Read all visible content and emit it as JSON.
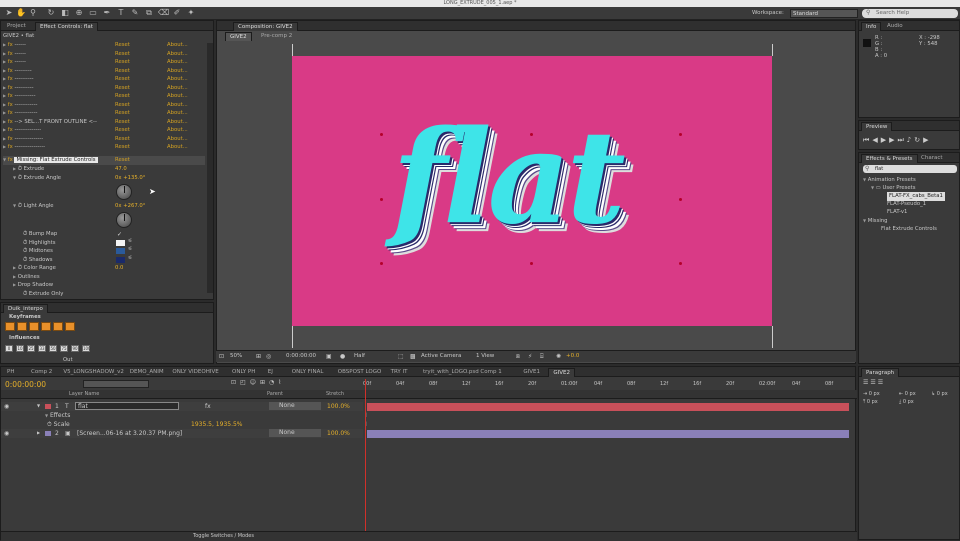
{
  "app": {
    "title": "LONG_EXTRUDE_005_1.aep *"
  },
  "workspace": {
    "label": "Workspace:",
    "value": "Standard",
    "search_placeholder": "Search Help"
  },
  "left_panel": {
    "tabs": [
      "Project",
      "Effect Controls: flat"
    ],
    "breadcrumb": "GIVE2 • flat",
    "effects": [
      {
        "name": "------",
        "reset": "Reset",
        "about": "About..."
      },
      {
        "name": "------",
        "reset": "Reset",
        "about": "About..."
      },
      {
        "name": "------",
        "reset": "Reset",
        "about": "About..."
      },
      {
        "name": "---------",
        "reset": "Reset",
        "about": "About..."
      },
      {
        "name": "----------",
        "reset": "Reset",
        "about": "About..."
      },
      {
        "name": "----------",
        "reset": "Reset",
        "about": "About..."
      },
      {
        "name": "-----------",
        "reset": "Reset",
        "about": "About..."
      },
      {
        "name": "------------",
        "reset": "Reset",
        "about": "About..."
      },
      {
        "name": "------------",
        "reset": "Reset",
        "about": "About..."
      },
      {
        "name": "--> SEL...T FRONT OUTLINE <--",
        "reset": "Reset",
        "about": "About..."
      },
      {
        "name": "--------------",
        "reset": "Reset",
        "about": "About..."
      },
      {
        "name": "---------------",
        "reset": "Reset",
        "about": "About..."
      },
      {
        "name": "----------------",
        "reset": "Reset",
        "about": "About..."
      }
    ],
    "missing": {
      "name": "Missing: Flat Extrude Controls",
      "reset": "Reset"
    },
    "props": {
      "extrude_label": "Extrude",
      "extrude_value": "47.0",
      "angle_label": "Extrude Angle",
      "angle_value": "0x +135.0°",
      "light_label": "Light Angle",
      "light_value": "0x +267.0°",
      "bump_label": "Bump Map",
      "highlights_label": "Highlights",
      "midtones_label": "Midtones",
      "shadows_label": "Shadows",
      "color_range_label": "Color Range",
      "color_range_value": "0.0",
      "outlines_label": "Outlines",
      "drop_shadow_label": "Drop Shadow",
      "extrude_only_label": "Extrude Only"
    }
  },
  "duik": {
    "tab": "Duik_interpo",
    "keyframes": "Keyframes",
    "influences": "Influences",
    "values": [
      "0",
      "10",
      "25",
      "33",
      "50",
      "75",
      "90",
      "100"
    ],
    "out_label": "Out"
  },
  "comp": {
    "tab": "Composition: GIVE2",
    "subtabs": [
      "GIVE2",
      "Pre-comp 2"
    ],
    "text": "flat",
    "zoom": "50%",
    "timecode": "0:00:00:00",
    "resolution": "Half",
    "camera": "Active Camera",
    "view": "1 View",
    "exposure": "+0.0"
  },
  "info": {
    "tabs": [
      "Info",
      "Audio"
    ],
    "r": "R :",
    "g": "G :",
    "b": "B :",
    "a": "A : 0",
    "x": "X : -298",
    "y": "Y : 548"
  },
  "preview": {
    "tab": "Preview"
  },
  "effects_presets": {
    "tabs": [
      "Effects & Presets",
      "Charact"
    ],
    "search": "flat",
    "tree": [
      "Animation Presets",
      "User Presets",
      "FLAT-FX_cabs_Beta1",
      "FLAT-Pseudo_1",
      "FLAT-v1",
      "Missing",
      "Flat Extrude Controls"
    ]
  },
  "timeline": {
    "tabs": [
      "PH",
      "Comp 2",
      "V5_LONGSHADOW_v2",
      "DEMO_ANIM",
      "ONLY VIDEOHIVE",
      "ONLY PH",
      "EJ",
      "ONLY FINAL",
      "OBSPOST LOGO",
      "TRY IT",
      "tryit_with_LOGO.psd Comp 1",
      "GIVE1",
      "GIVE2"
    ],
    "timecode": "0:00:00:00",
    "headers": {
      "layer_name": "Layer Name",
      "parent": "Parent",
      "stretch": "Stretch"
    },
    "ruler": [
      "00f",
      "04f",
      "08f",
      "12f",
      "16f",
      "20f",
      "01:00f",
      "04f",
      "08f",
      "12f",
      "16f",
      "20f",
      "02:00f",
      "04f",
      "08f"
    ],
    "layers": [
      {
        "num": "1",
        "name": "flat",
        "parent": "None",
        "stretch": "100.0%"
      },
      {
        "num": "2",
        "name": "[Screen...06-16 at 3.20.37 PM.png]",
        "parent": "None",
        "stretch": "100.0%"
      }
    ],
    "effects_label": "Effects",
    "scale_label": "Scale",
    "scale_value": "1935.5, 1935.5%",
    "toggle": "Toggle Switches / Modes"
  },
  "paragraph": {
    "tab": "Paragraph",
    "px": [
      "0 px",
      "0 px",
      "0 px",
      "0 px",
      "0 px"
    ]
  }
}
